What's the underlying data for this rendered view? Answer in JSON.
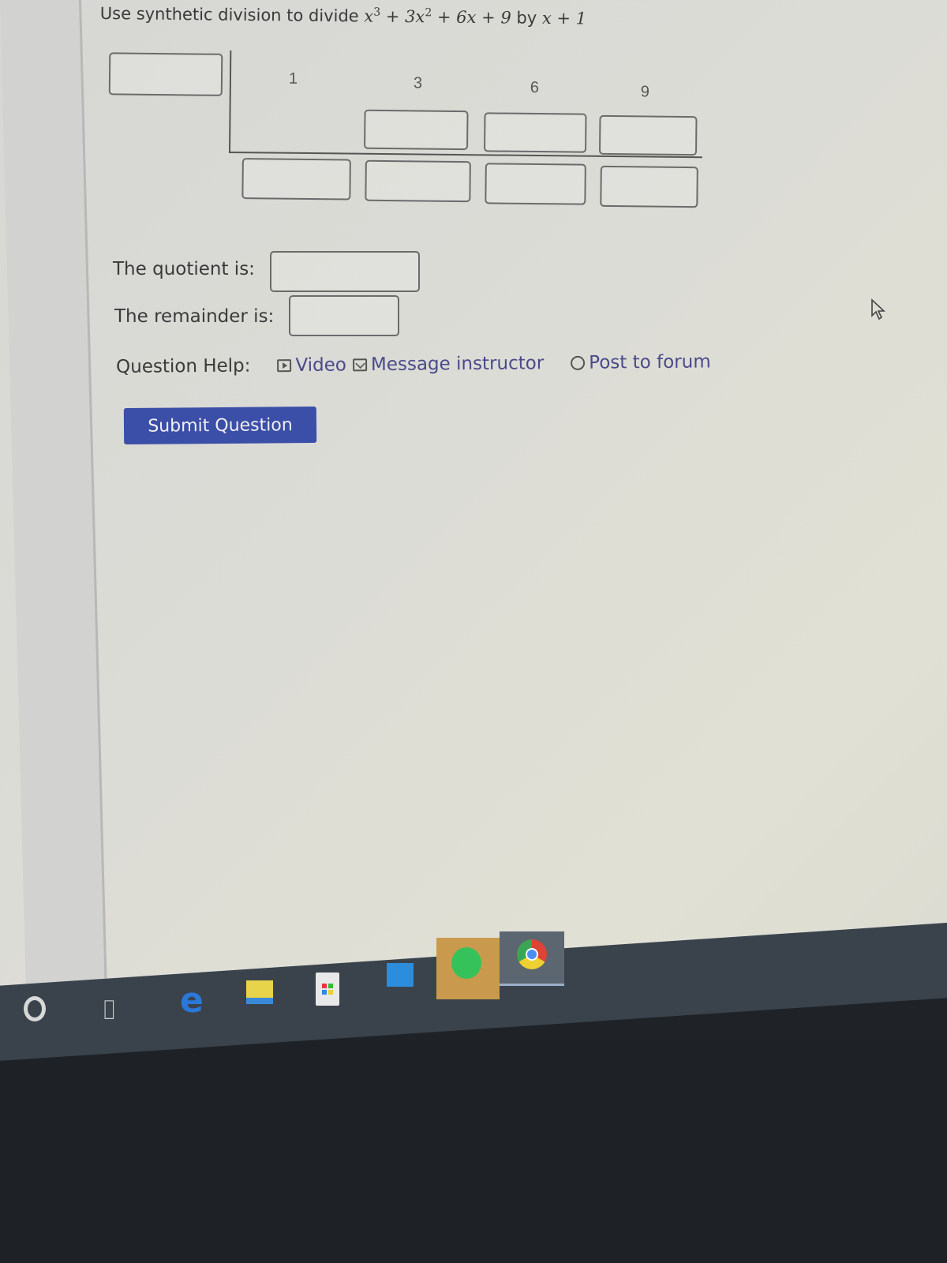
{
  "question": {
    "prefix": "Use synthetic division to divide",
    "dividend": {
      "term1_var": "x",
      "term1_exp": "3",
      "op1": "+",
      "term2_coef": "3",
      "term2_var": "x",
      "term2_exp": "2",
      "op2": "+",
      "term3_coef": "6",
      "term3_var": "x",
      "op3": "+",
      "term4": "9"
    },
    "by": "by",
    "divisor": {
      "var": "x",
      "op": "+",
      "const": "1"
    }
  },
  "synthetic_division": {
    "divisor_input": "",
    "coefficients": [
      "1",
      "3",
      "6",
      "9"
    ],
    "middle_row_inputs": [
      "",
      "",
      ""
    ],
    "bottom_row_inputs": [
      "",
      "",
      "",
      ""
    ]
  },
  "answers": {
    "quotient_label": "The quotient is:",
    "quotient_value": "",
    "remainder_label": "The remainder is:",
    "remainder_value": ""
  },
  "help": {
    "label": "Question Help:",
    "links": [
      {
        "icon": "video-icon",
        "label": "Video"
      },
      {
        "icon": "mail-icon",
        "label": "Message instructor"
      },
      {
        "icon": "forum-bubble-icon",
        "label": "Post to forum"
      }
    ]
  },
  "submit_label": "Submit Question",
  "taskbar": {
    "items": [
      "cortana",
      "task-view",
      "edge",
      "file-explorer",
      "microsoft-store",
      "mail",
      "spotify",
      "chrome"
    ],
    "colors": {
      "bar": "#3a434c",
      "spotify_active": "#c99a4d",
      "chrome_active": "#5c6670"
    }
  },
  "colors": {
    "link": "#4a4a8a",
    "submit_bg": "#3b4ea8",
    "text": "#3a3a3a"
  }
}
